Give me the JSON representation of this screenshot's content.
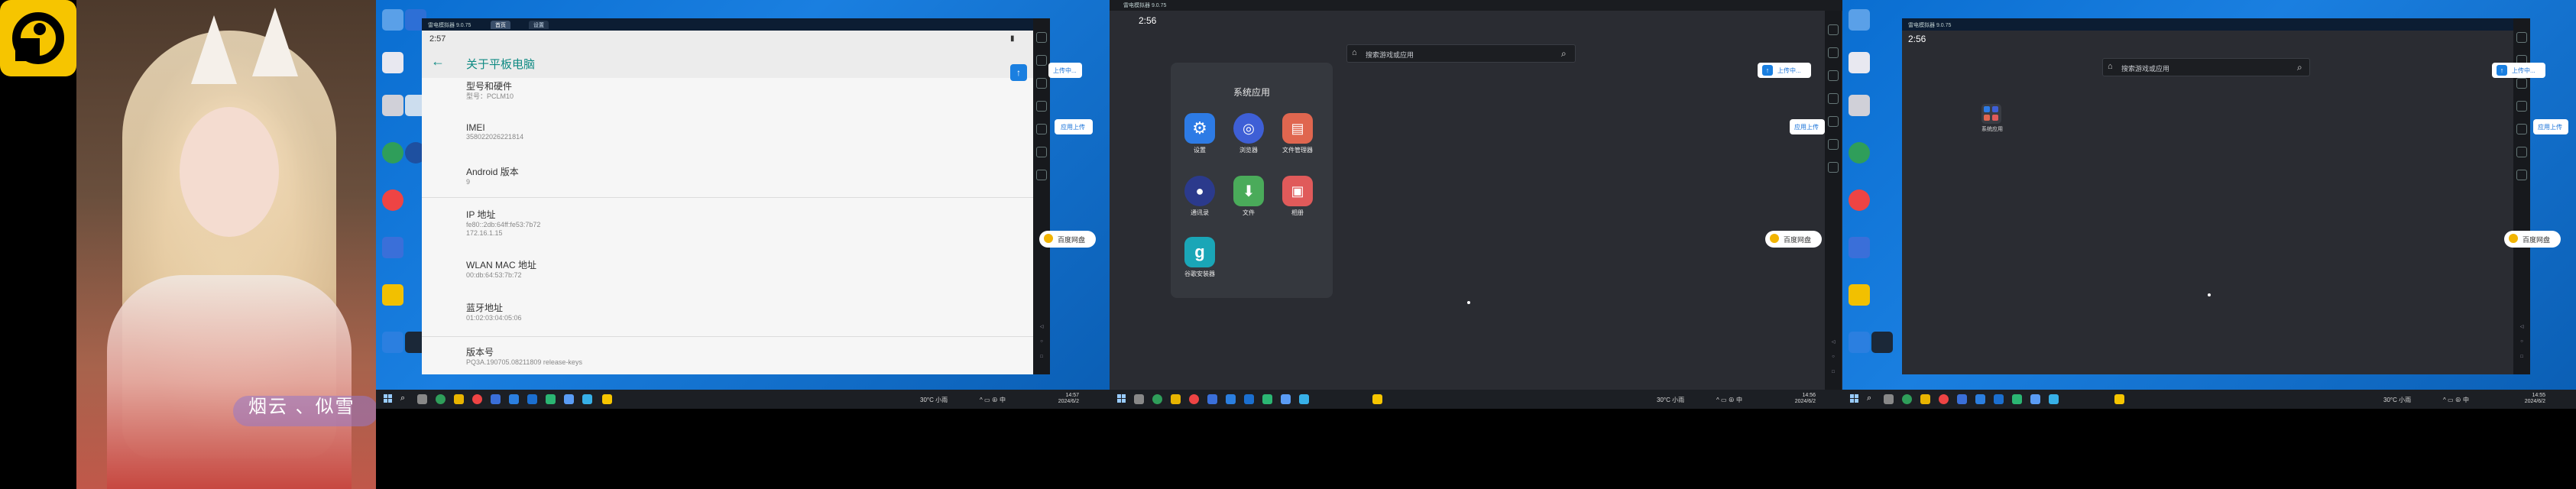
{
  "portrait": {
    "caption": "烟云 、似雪"
  },
  "screens": [
    {
      "emulator": {
        "title": "雷电模拟器 9.0.75",
        "tabs": [
          "首页",
          "设置"
        ],
        "status_time": "2:57"
      },
      "page": {
        "title": "关于平板电脑",
        "back_icon": "arrow-left-icon",
        "items": [
          {
            "title": "型号和硬件",
            "value": "型号：PCLM10"
          },
          {
            "title": "IMEI",
            "value": "358022026221814"
          },
          {
            "title": "Android 版本",
            "value": "9"
          },
          {
            "title": "IP 地址",
            "value": "fe80::2db:64ff:fe53:7b72\n172.16.1.15"
          },
          {
            "title": "WLAN MAC 地址",
            "value": "00:db:64:53:7b:72"
          },
          {
            "title": "蓝牙地址",
            "value": "01:02:03:04:05:06"
          },
          {
            "title": "版本号",
            "value": "PQ3A.190705.08211809 release-keys"
          }
        ]
      },
      "float_button": "上传中...",
      "side_pill": "应用上传",
      "cloud_label": "百度网盘",
      "taskbar": {
        "weather": "30°C 小雨",
        "time": "14:57",
        "date": "2024/6/2"
      }
    },
    {
      "emulator": {
        "title": "雷电模拟器 9.0.75",
        "status_time": "2:56"
      },
      "search_placeholder": "搜索游戏或应用",
      "folder": {
        "title": "系统应用",
        "apps": [
          {
            "label": "设置",
            "color": "#2d7be5"
          },
          {
            "label": "浏览器",
            "color": "#3e5fd6"
          },
          {
            "label": "文件管理器",
            "color": "#e0664f"
          },
          {
            "label": "通讯录",
            "color": "#2b3a8c"
          },
          {
            "label": "文件",
            "color": "#4aab5a"
          },
          {
            "label": "相册",
            "color": "#e05a5a"
          },
          {
            "label": "谷歌安装器",
            "color": "#1aa6b7"
          }
        ]
      },
      "float_button": "上传中...",
      "side_pill": "应用上传",
      "cloud_label": "百度网盘",
      "taskbar": {
        "weather": "30°C 小雨",
        "time": "14:56",
        "date": "2024/6/2"
      }
    },
    {
      "emulator": {
        "title": "雷电模拟器 9.0.75",
        "status_time": "2:56"
      },
      "search_placeholder": "搜索游戏或应用",
      "folder_shortcut_label": "系统应用",
      "float_button": "上传中...",
      "side_pill": "应用上传",
      "cloud_label": "百度网盘",
      "taskbar": {
        "weather": "30°C 小雨",
        "time": "14:55",
        "date": "2024/6/2"
      }
    }
  ],
  "colors": {
    "accent_teal": "#0f8a83",
    "windows_blue": "#0a6ed1",
    "taskbar": "#1c1f24",
    "logo_yellow": "#F6C500"
  }
}
